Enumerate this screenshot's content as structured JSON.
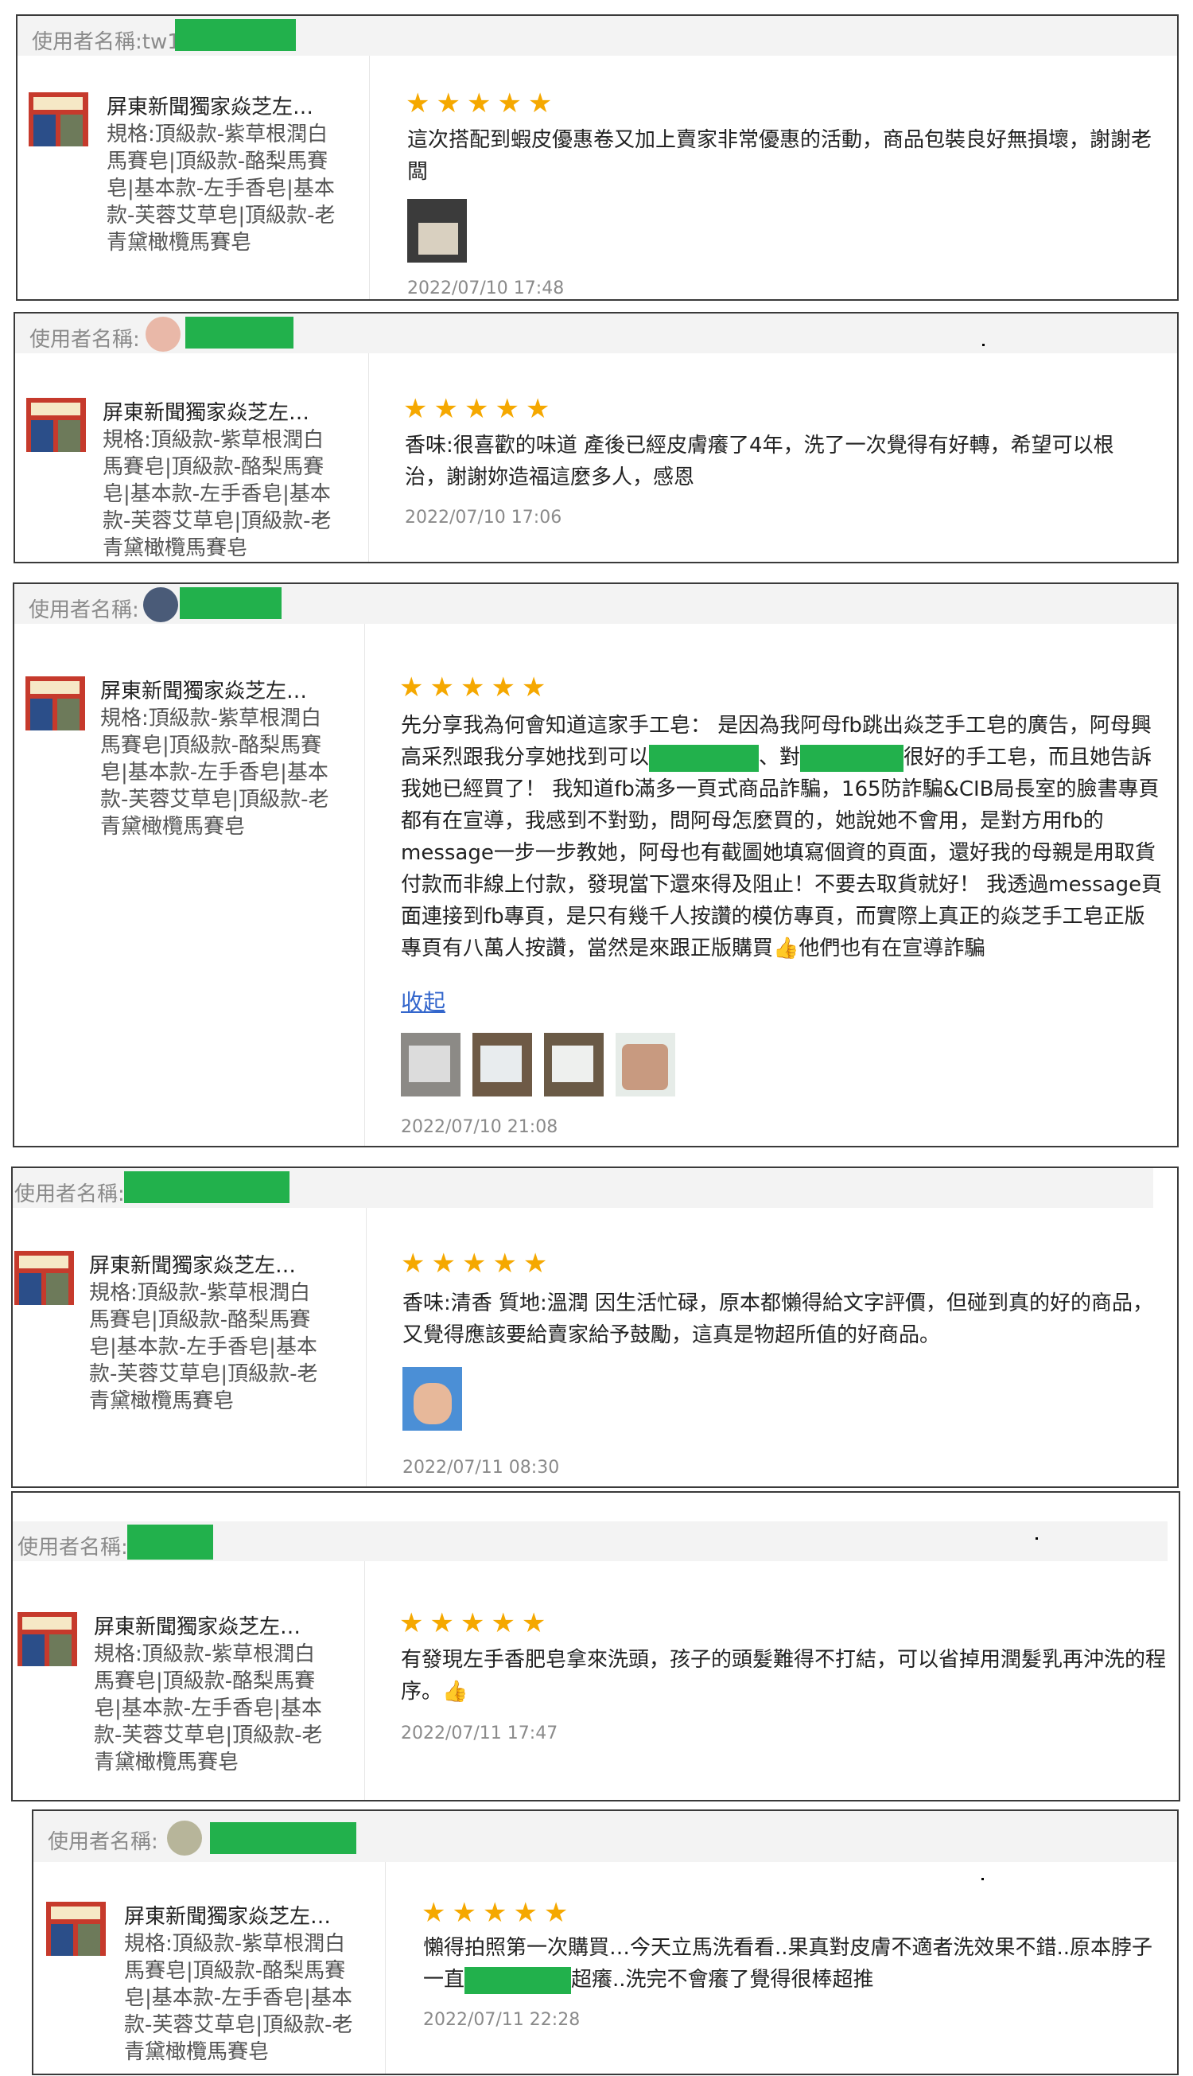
{
  "reviews": [
    {
      "user_label": "使用者名稱:tw1",
      "product_name": "屏東新聞獨家焱芝左…",
      "product_variant": "規格:頂級款-紫草根潤白馬賽皂|頂級款-酪梨馬賽皂|基本款-左手香皂|基本款-芙蓉艾草皂|頂級款-老青黛橄欖馬賽皂",
      "rating": 5,
      "text": "這次搭配到蝦皮優惠卷又加上賣家非常優惠的活動，商品包裝良好無損壞，謝謝老闆",
      "date": "2022/07/10 17:48"
    },
    {
      "user_label": "使用者名稱:",
      "product_name": "屏東新聞獨家焱芝左…",
      "product_variant": "規格:頂級款-紫草根潤白馬賽皂|頂級款-酪梨馬賽皂|基本款-左手香皂|基本款-芙蓉艾草皂|頂級款-老青黛橄欖馬賽皂",
      "rating": 5,
      "text": "香味:很喜歡的味道 產後已經皮膚癢了4年，洗了一次覺得有好轉，希望可以根治，謝謝妳造福這麼多人，感恩",
      "date": "2022/07/10 17:06"
    },
    {
      "user_label": "使用者名稱:",
      "product_name": "屏東新聞獨家焱芝左…",
      "product_variant": "規格:頂級款-紫草根潤白馬賽皂|頂級款-酪梨馬賽皂|基本款-左手香皂|基本款-芙蓉艾草皂|頂級款-老青黛橄欖馬賽皂",
      "rating": 5,
      "text_a": "先分享我為何會知道這家手工皂： 是因為我阿母fb跳出焱芝手工皂的廣告，阿母興高采烈跟我分享她找到可以",
      "text_b": "、對",
      "text_c": "很好的手工皂，而且她告訴我她已經買了！ 我知道fb滿多一頁式商品詐騙，165防詐騙&CIB局長室的臉書專頁都有在宣導，我感到不對勁，問阿母怎麼買的，她說她不會用，是對方用fb的message一步一步教她，阿母也有截圖她填寫個資的頁面，還好我的母親是用取貨付款而非線上付款，發現當下還來得及阻止！不要去取貨就好！ 我透過message頁面連接到fb專頁，是只有幾千人按讚的模仿專頁，而實際上真正的焱芝手工皂正版專頁有八萬人按讚，當然是來跟正版購買",
      "text_emoji": "👍",
      "text_d": "他們也有在宣導詐騙",
      "collapse_label": "收起",
      "date": "2022/07/10 21:08"
    },
    {
      "user_label": "使用者名稱:",
      "product_name": "屏東新聞獨家焱芝左…",
      "product_variant": "規格:頂級款-紫草根潤白馬賽皂|頂級款-酪梨馬賽皂|基本款-左手香皂|基本款-芙蓉艾草皂|頂級款-老青黛橄欖馬賽皂",
      "rating": 5,
      "text": "香味:清香 質地:溫潤 因生活忙碌，原本都懶得給文字評價，但碰到真的好的商品，又覺得應該要給賣家給予鼓勵，這真是物超所值的好商品。",
      "date": "2022/07/11 08:30"
    },
    {
      "user_label": "使用者名稱:",
      "product_name": "屏東新聞獨家焱芝左…",
      "product_variant": "規格:頂級款-紫草根潤白馬賽皂|頂級款-酪梨馬賽皂|基本款-左手香皂|基本款-芙蓉艾草皂|頂級款-老青黛橄欖馬賽皂",
      "rating": 5,
      "text": "有發現左手香肥皂拿來洗頭，孩子的頭髮難得不打結，可以省掉用潤髮乳再沖洗的程序。👍",
      "date": "2022/07/11 17:47"
    },
    {
      "user_label": "使用者名稱:",
      "product_name": "屏東新聞獨家焱芝左…",
      "product_variant": "規格:頂級款-紫草根潤白馬賽皂|頂級款-酪梨馬賽皂|基本款-左手香皂|基本款-芙蓉艾草皂|頂級款-老青黛橄欖馬賽皂",
      "rating": 5,
      "text_a": "懶得拍照第一次購買…今天立馬洗看看..果真對皮膚不適者洗效果不錯..原本脖子一直",
      "text_b": "超癢..洗完不會癢了覺得很棒超推",
      "date": "2022/07/11 22:28"
    }
  ],
  "stars_glyph": "★★★★★",
  "colors": {
    "star": "#f5a800",
    "mask": "#22b14c",
    "link": "#3366cc"
  }
}
